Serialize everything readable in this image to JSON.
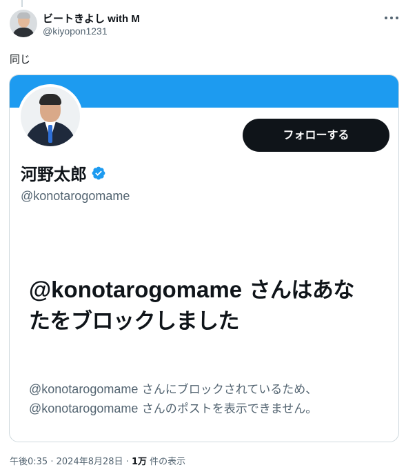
{
  "tweet": {
    "author_name": "ビートきよし with M",
    "author_handle": "@kiyopon1231",
    "text": "同じ",
    "time": "午後0:35",
    "separator": "·",
    "date": "2024年8月28日",
    "views_count": "1万",
    "views_label": "件の表示"
  },
  "embedded_profile": {
    "banner_color": "#1d9bf0",
    "follow_button_label": "フォローする",
    "name": "河野太郎",
    "verified": true,
    "handle": "@konotarogomame",
    "blocked_heading_handle": "@konotarogomame",
    "blocked_heading_rest": "さんはあなたをブロックしました",
    "blocked_desc_handle_1": "@konotarogomame",
    "blocked_desc_rest_1": "さんにブロックされているため、",
    "blocked_desc_handle_2": "@konotarogomame",
    "blocked_desc_rest_2": "さんのポストを表示できません。"
  },
  "icons": {
    "more": "more-dots-icon",
    "verified": "verified-badge-icon"
  },
  "colors": {
    "accent_blue": "#1d9bf0",
    "text_primary": "#0f1419",
    "text_secondary": "#536471",
    "border": "#cfd9de"
  }
}
